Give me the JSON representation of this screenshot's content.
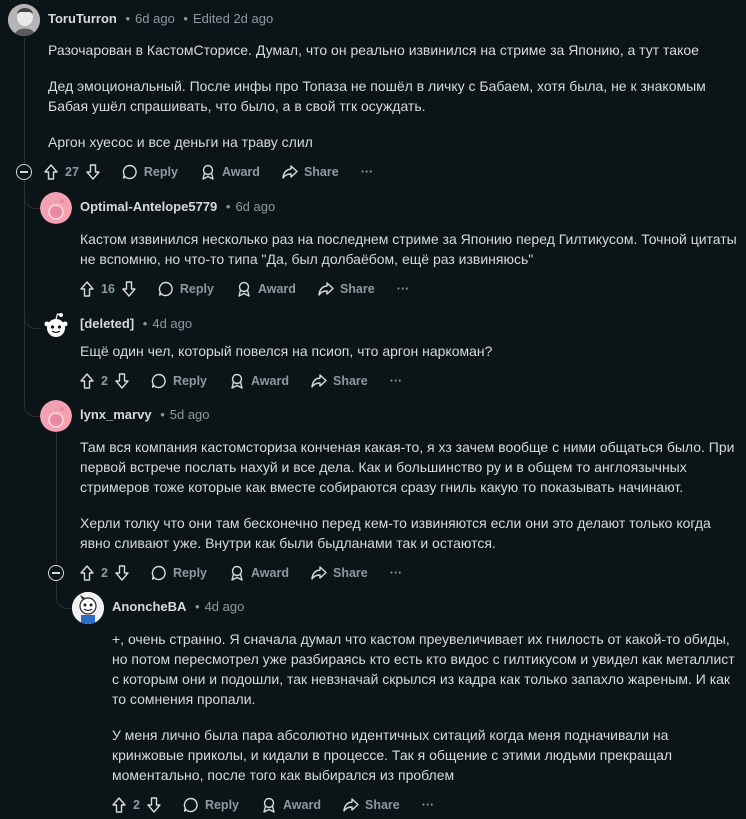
{
  "comments": [
    {
      "author": "ToruTurron",
      "time": "6d ago",
      "edited": "Edited 2d ago",
      "paragraphs": [
        "Разочарован в КастомСторисе. Думал, что он реально извинился на стриме за Японию, а тут такое",
        "Дед эмоциональный. После инфы про Топаза не пошёл в личку с Бабаем, хотя была, не к знакомым Бабая ушёл спрашивать, что было, а в свой тгк осуждать.",
        "Аргон хуесос и все деньги на траву слил"
      ],
      "votes": "27"
    },
    {
      "author": "Optimal-Antelope5779",
      "time": "6d ago",
      "paragraphs": [
        "Кастом извинился несколько раз на последнем стриме за Японию перед Гилтикусом. Точной цитаты не вспомню, но что-то типа \"Да, был долбаёбом, ещё раз извиняюсь\""
      ],
      "votes": "16"
    },
    {
      "author": "[deleted]",
      "time": "4d ago",
      "paragraphs": [
        "Ещё один чел, который повелся на псиоп, что аргон наркоман?"
      ],
      "votes": "2"
    },
    {
      "author": "lynx_marvy",
      "time": "5d ago",
      "paragraphs": [
        "Там вся компания кастомсториза конченая какая-то, я хз зачем вообще с ними общаться было. При первой встрече послать нахуй и все дела. Как и большинство ру и в общем то англоязычных стримеров тоже которые как вместе собираются сразу гниль какую то показывать начинают.",
        "Херли толку что они там бесконечно перед кем-то извиняются если они это делают только когда явно сливают уже. Внутри как были быдланами так и остаются."
      ],
      "votes": "2"
    },
    {
      "author": "AnoncheBA",
      "time": "4d ago",
      "paragraphs": [
        "+, очень странно. Я сначала думал что кастом преувеличивает их гнилость от какой-то обиды, но потом пересмотрел уже разбираясь кто есть кто видос с гилтикусом и увидел как металлист с которым они и подошли, так невзначай скрылся из кадра как только запахло жареным. И как то сомнения пропали.",
        "У меня лично была пара абсолютно идентичных ситаций когда меня подначивали на кринжовые приколы, и кидали в процессе. Так я общение с этими людьми прекращал моментально, после того как выбирался из проблем"
      ],
      "votes": "2"
    }
  ],
  "labels": {
    "reply": "Reply",
    "award": "Award",
    "share": "Share",
    "more": "···",
    "dot": "•"
  },
  "colors": {
    "background": "#0b1416",
    "text": "#d7dadc",
    "muted": "#8b9aa0",
    "thread_line": "#2a3236",
    "avatar_pink": "#f3a0b1"
  },
  "icons": [
    "upvote-icon",
    "downvote-icon",
    "comment-icon",
    "award-icon",
    "share-icon",
    "more-icon",
    "collapse-icon",
    "snoo-avatar"
  ]
}
